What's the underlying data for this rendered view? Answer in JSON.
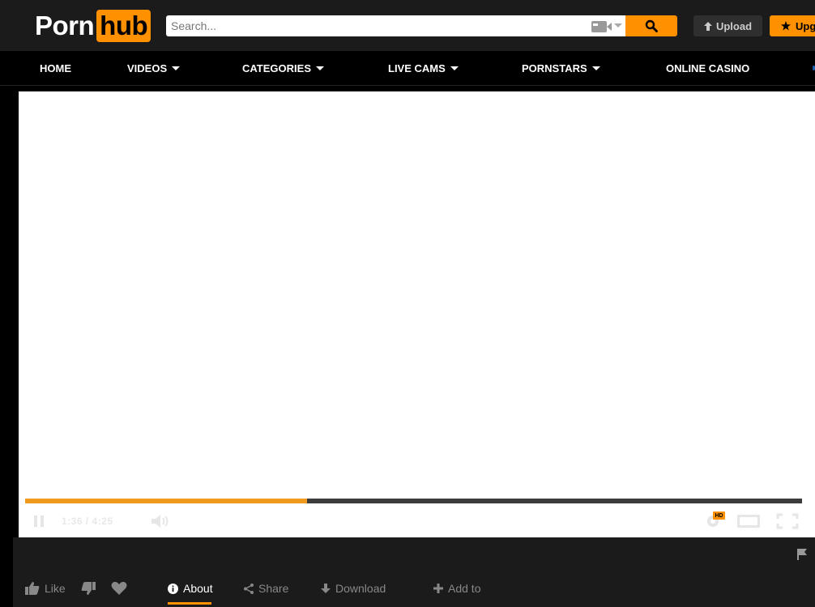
{
  "header": {
    "logo_left": "Porn",
    "logo_right": "hub",
    "search_placeholder": "Search...",
    "upload_label": "Upload",
    "upgrade_label": "Upg"
  },
  "nav": [
    {
      "label": "HOME",
      "dropdown": false
    },
    {
      "label": "VIDEOS",
      "dropdown": true
    },
    {
      "label": "CATEGORIES",
      "dropdown": true
    },
    {
      "label": "LIVE CAMS",
      "dropdown": true
    },
    {
      "label": "PORNSTARS",
      "dropdown": true
    },
    {
      "label": "ONLINE CASINO",
      "dropdown": false
    }
  ],
  "player": {
    "progress": 0.363,
    "time": "1:36 / 4:25",
    "hd_label": "HD"
  },
  "actions": {
    "like": "Like",
    "about": "About",
    "share": "Share",
    "download": "Download",
    "add_to": "Add to"
  },
  "colors": {
    "accent": "#ff9000",
    "header_bg": "#1b1b1b",
    "progress": "#f09b1f"
  }
}
